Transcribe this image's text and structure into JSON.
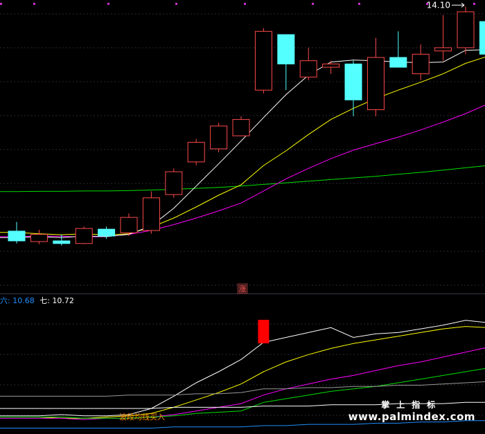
{
  "chart_data": [
    {
      "type": "candlestick",
      "panel": "main",
      "ylim": [
        5.5,
        14.3
      ],
      "grid": true,
      "max_label": "14.10",
      "signal_badge": "涨",
      "colors": {
        "up": "#ff4a4a",
        "down": "#54ffff",
        "ma5": "#ffffff",
        "ma10": "#ffff00",
        "ma20": "#ff00ff",
        "ma60": "#00e000"
      },
      "candles": [
        {
          "o": 7.22,
          "h": 7.5,
          "l": 6.84,
          "c": 6.92
        },
        {
          "o": 6.9,
          "h": 7.26,
          "l": 6.82,
          "c": 7.12
        },
        {
          "o": 6.92,
          "h": 7.12,
          "l": 6.78,
          "c": 6.84
        },
        {
          "o": 6.84,
          "h": 7.36,
          "l": 6.82,
          "c": 7.3
        },
        {
          "o": 7.28,
          "h": 7.36,
          "l": 6.98,
          "c": 7.07
        },
        {
          "o": 7.17,
          "h": 7.76,
          "l": 7.07,
          "c": 7.64
        },
        {
          "o": 7.24,
          "h": 8.44,
          "l": 7.14,
          "c": 8.24
        },
        {
          "o": 8.34,
          "h": 9.14,
          "l": 8.24,
          "c": 9.04
        },
        {
          "o": 9.34,
          "h": 10.04,
          "l": 9.24,
          "c": 9.94
        },
        {
          "o": 9.74,
          "h": 10.54,
          "l": 9.64,
          "c": 10.44
        },
        {
          "o": 10.14,
          "h": 10.74,
          "l": 10.14,
          "c": 10.64
        },
        {
          "o": 11.54,
          "h": 13.44,
          "l": 11.44,
          "c": 13.34
        },
        {
          "o": 13.24,
          "h": 13.24,
          "l": 11.54,
          "c": 12.34
        },
        {
          "o": 11.94,
          "h": 12.84,
          "l": 11.84,
          "c": 12.44
        },
        {
          "o": 12.24,
          "h": 12.44,
          "l": 12.04,
          "c": 12.34
        },
        {
          "o": 12.34,
          "h": 12.44,
          "l": 10.74,
          "c": 11.24
        },
        {
          "o": 10.94,
          "h": 13.14,
          "l": 10.74,
          "c": 12.54
        },
        {
          "o": 12.54,
          "h": 13.34,
          "l": 12.34,
          "c": 12.24
        },
        {
          "o": 12.04,
          "h": 12.94,
          "l": 11.84,
          "c": 12.64
        },
        {
          "o": 12.74,
          "h": 13.84,
          "l": 12.44,
          "c": 12.84
        },
        {
          "o": 12.84,
          "h": 14.1,
          "l": 12.64,
          "c": 13.94
        },
        {
          "o": 13.64,
          "h": 14.0,
          "l": 12.24,
          "c": 12.64
        },
        {
          "o": 12.44,
          "h": 12.74,
          "l": 11.94,
          "c": 12.04
        }
      ],
      "ma_lines": [
        {
          "key": "ma60",
          "values": [
            8.43,
            8.44,
            8.44,
            8.45,
            8.45,
            8.46,
            8.48,
            8.5,
            8.53,
            8.56,
            8.6,
            8.65,
            8.7,
            8.75,
            8.8,
            8.85,
            8.9,
            8.96,
            9.02,
            9.09,
            9.16,
            9.23,
            9.28
          ]
        },
        {
          "key": "ma20",
          "values": [
            7.05,
            7.07,
            7.06,
            7.04,
            7.05,
            7.12,
            7.24,
            7.42,
            7.62,
            7.84,
            8.08,
            8.45,
            8.82,
            9.14,
            9.44,
            9.7,
            9.9,
            10.1,
            10.32,
            10.56,
            10.82,
            11.12,
            11.3
          ]
        },
        {
          "key": "ma10",
          "values": [
            7.18,
            7.14,
            7.11,
            7.14,
            7.1,
            7.14,
            7.34,
            7.62,
            7.96,
            8.32,
            8.64,
            9.23,
            9.68,
            10.18,
            10.64,
            10.98,
            11.28,
            11.54,
            11.78,
            12.04,
            12.36,
            12.58,
            12.5
          ]
        },
        {
          "key": "ma5",
          "values": [
            7.02,
            7.05,
            7.02,
            7.07,
            7.05,
            7.12,
            7.38,
            7.92,
            8.6,
            9.28,
            9.98,
            10.7,
            11.4,
            12.0,
            12.4,
            12.46,
            12.44,
            12.4,
            12.38,
            12.4,
            12.76,
            12.78,
            12.62
          ]
        }
      ]
    },
    {
      "type": "line",
      "panel": "sub",
      "legend": [
        {
          "label": "六: 10.68",
          "color": "#1e90ff"
        },
        {
          "label": "七: 10.72",
          "color": "#ffffff"
        }
      ],
      "annotation": "波段均线买入",
      "bar_marker_index": 11,
      "ylim": [
        0,
        100
      ],
      "series": [
        {
          "color": "#ffffff",
          "values": [
            12,
            12,
            13,
            12,
            12,
            13,
            18,
            28,
            39,
            48,
            58,
            72,
            76,
            80,
            84,
            76,
            79,
            80,
            83,
            86,
            90,
            88,
            85
          ]
        },
        {
          "color": "#ffff00",
          "values": [
            11,
            11,
            10,
            10,
            11,
            12,
            14,
            19,
            25,
            31,
            38,
            48,
            56,
            62,
            67,
            71,
            74,
            77,
            80,
            83,
            85,
            84,
            83
          ]
        },
        {
          "color": "#ff00ff",
          "values": [
            10,
            10,
            10,
            9,
            10,
            10,
            11,
            13,
            16,
            19,
            22,
            29,
            34,
            38,
            42,
            45,
            49,
            53,
            56,
            60,
            64,
            68,
            71
          ]
        },
        {
          "color": "#00e000",
          "values": [
            11,
            11,
            11,
            10,
            10,
            10,
            11,
            12,
            14,
            15,
            16,
            23,
            26,
            29,
            32,
            34,
            36,
            39,
            42,
            45,
            48,
            51,
            53
          ]
        },
        {
          "color": "#9a9a9a",
          "values": [
            28,
            28,
            28,
            28,
            28,
            29,
            29,
            29,
            30,
            30,
            31,
            34,
            34,
            35,
            35,
            36,
            36,
            37,
            37,
            38,
            39,
            40,
            41
          ]
        },
        {
          "color": "#1e90ff",
          "values": [
            2,
            2,
            2,
            2,
            2,
            2,
            2,
            3,
            3,
            3,
            3,
            4,
            4,
            5,
            5,
            5,
            6,
            6,
            7,
            7,
            8,
            8,
            9
          ]
        },
        {
          "color": "#ffffff",
          "values": [
            18,
            18,
            18,
            18,
            18,
            18,
            18,
            19,
            19,
            19,
            19,
            20,
            20,
            20,
            21,
            21,
            21,
            22,
            22,
            22,
            23,
            23,
            23
          ]
        }
      ]
    }
  ],
  "watermark": {
    "cn": "掌上指标",
    "url": "www.palmindex.com"
  }
}
